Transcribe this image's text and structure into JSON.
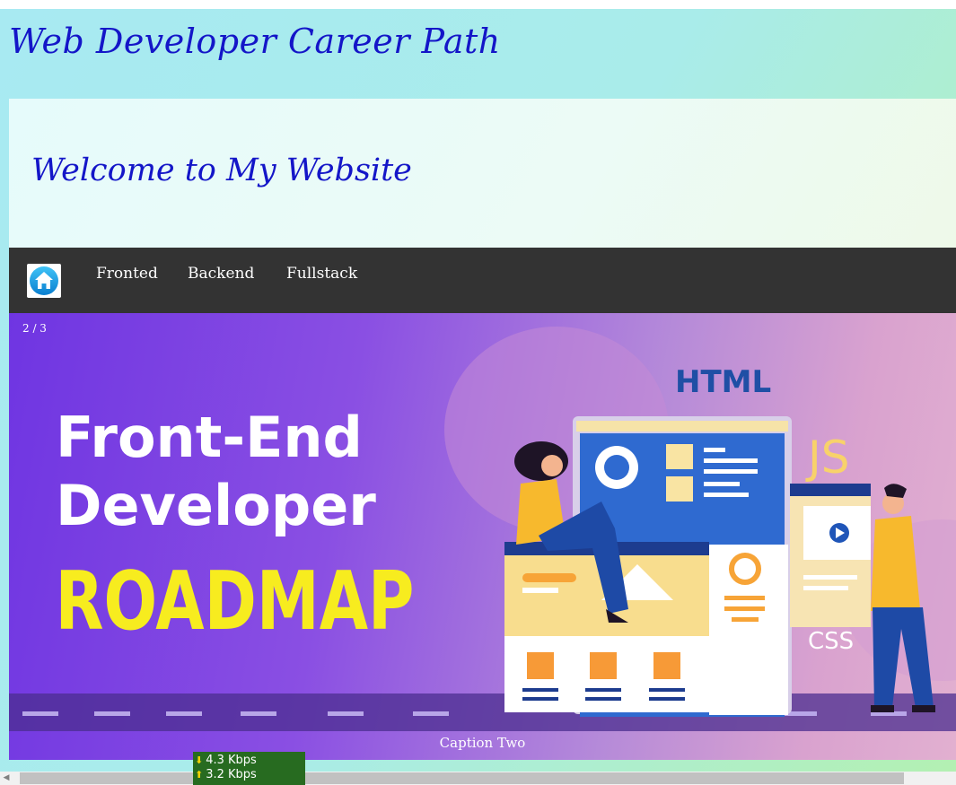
{
  "header": {
    "site_title": "Web Developer Career Path",
    "welcome_title": "Welcome to My Website"
  },
  "nav": {
    "home_icon": "home-icon",
    "links": [
      "Fronted",
      "Backend",
      "Fullstack"
    ]
  },
  "slideshow": {
    "counter": "2 / 3",
    "caption": "Caption Two",
    "image": {
      "line1": "Front-End",
      "line2": "Developer",
      "line3": "ROADMAP",
      "label_html": "HTML",
      "label_js": "JS",
      "label_css": "CSS"
    }
  },
  "network_meter": {
    "download": "4.3 Kbps",
    "upload": "3.2 Kbps"
  },
  "colors": {
    "title_blue": "#1416c8",
    "navbar_bg": "#333333",
    "roadmap_yellow": "#f7ec1f",
    "meter_green": "#276b20"
  }
}
